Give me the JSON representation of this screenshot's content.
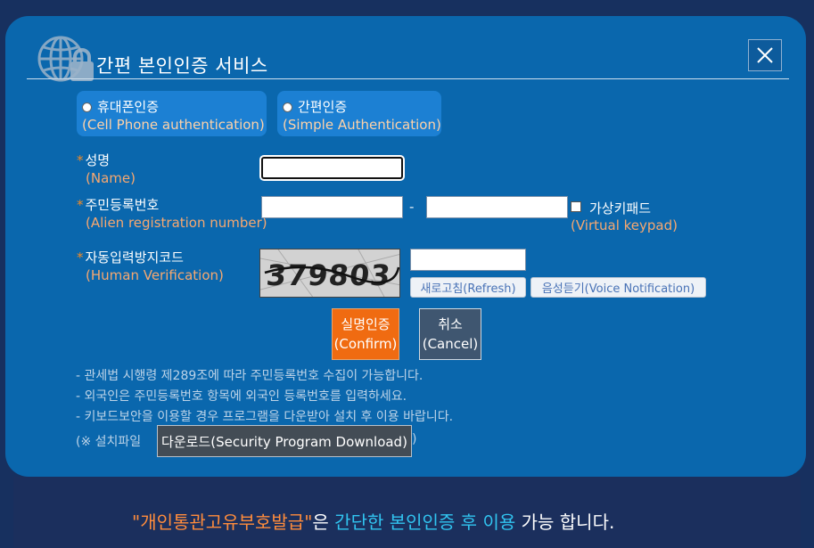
{
  "dialog": {
    "title": "간편 본인인증 서비스",
    "close_label": "X"
  },
  "methods": [
    {
      "label": "휴대폰인증",
      "sub": "(Cell Phone authentication)",
      "selected": false
    },
    {
      "label": "간편인증",
      "sub": "(Simple Authentication)",
      "selected": false
    }
  ],
  "form": {
    "required_mark": "*",
    "name_label": "성명",
    "name_sub": "(Name)",
    "name_value": "",
    "regno_label": "주민등록번호",
    "regno_sub": "(Alien registration number)",
    "regno_separator": "-",
    "regno_front_value": "",
    "regno_back_value": "",
    "virtual_keypad_label": "가상키패드",
    "virtual_keypad_sub": "(Virtual keypad)",
    "virtual_keypad_checked": false,
    "captcha_label": "자동입력방지코드",
    "captcha_sub": "(Human Verification)",
    "captcha_text": "379803",
    "captcha_value": "",
    "refresh_label": "새로고침(Refresh)",
    "voice_label": "음성듣기(Voice Notification)"
  },
  "buttons": {
    "confirm_line1": "실명인증",
    "confirm_line2": "(Confirm)",
    "cancel_line1": "취소",
    "cancel_line2": "(Cancel)"
  },
  "notes": [
    "- 관세법 시행령 제289조에 따라 주민등록번호 수집이 가능합니다.",
    "- 외국인은 주민등록번호 항목에 외국인 등록번호를 입력하세요.",
    "- 키보드보안을 이용할 경우 프로그램을 다운받아 설치 후 이용 바랍니다."
  ],
  "download": {
    "prefix": "(※ 설치파일",
    "button_label": "다운로드(Security Program Download)",
    "suffix": ")"
  },
  "footer": {
    "part1": "\"개인통관고유부호발급\"",
    "part2": "은 ",
    "part3": "간단한 본인인증 후 이용",
    "part4": " 가능 합니다."
  },
  "colors": {
    "dialog_bg": "#0a67ad",
    "confirm_bg": "#f06b11",
    "cancel_bg": "#3f5670",
    "label_sub": "#f7a870"
  }
}
